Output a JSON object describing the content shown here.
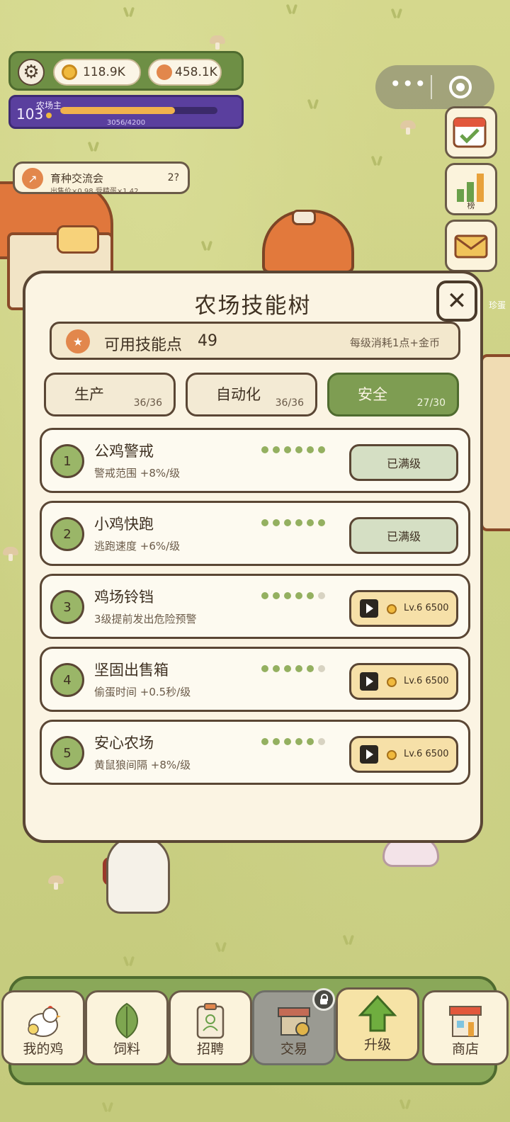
{
  "hud": {
    "gold": "118.9K",
    "eggs": "458.1K",
    "level": "103",
    "role": "农场主",
    "xp_text": "3056/4200",
    "xp_progress": 0.7276
  },
  "event": {
    "title": "育种交流会",
    "subtitle": "出售价×0.98 受精蛋×1.42",
    "count": "2?"
  },
  "side_buttons": {
    "rank_label": "榜"
  },
  "right_house_text": "珍蛋",
  "modal": {
    "title": "农场技能树",
    "close_glyph": "✕",
    "points_label": "可用技能点",
    "points_value": "49",
    "points_hint": "每级消耗1点+金币",
    "star_glyph": "★",
    "tabs": [
      {
        "label": "生产",
        "count": "36/36"
      },
      {
        "label": "自动化",
        "count": "36/36"
      },
      {
        "label": "安全",
        "count": "27/30"
      }
    ],
    "skills": [
      {
        "num": "1",
        "name": "公鸡警戒",
        "desc": "警戒范围 +8%/级",
        "level": 6,
        "max": 6,
        "action": "已满级"
      },
      {
        "num": "2",
        "name": "小鸡快跑",
        "desc": "逃跑速度 +6%/级",
        "level": 6,
        "max": 6,
        "action": "已满级"
      },
      {
        "num": "3",
        "name": "鸡场铃铛",
        "desc": "3级提前发出危险预警",
        "level": 5,
        "max": 6,
        "action": "Lv.6 6500"
      },
      {
        "num": "4",
        "name": "坚固出售箱",
        "desc": "偷蛋时间 +0.5秒/级",
        "level": 5,
        "max": 6,
        "action": "Lv.6 6500"
      },
      {
        "num": "5",
        "name": "安心农场",
        "desc": "黄鼠狼间隔 +8%/级",
        "level": 5,
        "max": 6,
        "action": "Lv.6 6500"
      }
    ]
  },
  "nav": [
    {
      "label": "我的鸡",
      "icon": "chicken-icon"
    },
    {
      "label": "饲料",
      "icon": "leaf-icon"
    },
    {
      "label": "招聘",
      "icon": "clipboard-icon"
    },
    {
      "label": "交易",
      "icon": "market-stall-icon"
    },
    {
      "label": "升级",
      "icon": "up-arrow-icon"
    },
    {
      "label": "商店",
      "icon": "shop-icon"
    }
  ],
  "colors": {
    "accent_green": "#7e9d52",
    "panel_bg": "#fbf4e3",
    "coin": "#f0b93d",
    "purple": "#5a3f9e"
  }
}
